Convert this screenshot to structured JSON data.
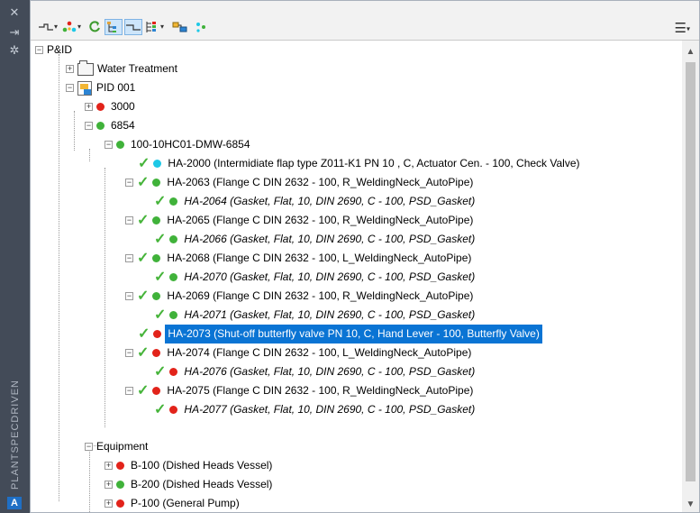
{
  "palette": {
    "title": "PLANTSPECDRIVEN",
    "close_glyph": "✕",
    "pin_glyph": "⇥",
    "settings_glyph": "✲",
    "logo_text": "A"
  },
  "toolbar": {
    "menu_glyph": "☰",
    "menu_caret": "▾"
  },
  "tree": {
    "rows": [
      {
        "text": "P&ID"
      },
      {
        "text": "Water Treatment"
      },
      {
        "text": "PID 001"
      },
      {
        "text": "3000"
      },
      {
        "text": "6854"
      },
      {
        "text": "100-10HC01-DMW-6854"
      },
      {
        "text": "HA-2000 (Intermidiate flap type Z011-K1 PN 10 , C, Actuator Cen. - 100, Check Valve)"
      },
      {
        "text": "HA-2063 (Flange C DIN 2632 - 100, R_WeldingNeck_AutoPipe)"
      },
      {
        "text": "HA-2064 (Gasket, Flat, 10, DIN 2690, C - 100, PSD_Gasket)"
      },
      {
        "text": "HA-2065 (Flange C DIN 2632 - 100, R_WeldingNeck_AutoPipe)"
      },
      {
        "text": "HA-2066 (Gasket, Flat, 10, DIN 2690, C - 100, PSD_Gasket)"
      },
      {
        "text": "HA-2068 (Flange C DIN 2632 - 100, L_WeldingNeck_AutoPipe)"
      },
      {
        "text": "HA-2070 (Gasket, Flat, 10, DIN 2690, C - 100, PSD_Gasket)"
      },
      {
        "text": "HA-2069 (Flange C DIN 2632 - 100, R_WeldingNeck_AutoPipe)"
      },
      {
        "text": "HA-2071 (Gasket, Flat, 10, DIN 2690, C - 100, PSD_Gasket)"
      },
      {
        "text": "HA-2073 (Shut-off butterfly valve PN 10, C, Hand Lever - 100, Butterfly Valve)"
      },
      {
        "text": "HA-2074 (Flange C DIN 2632 - 100, L_WeldingNeck_AutoPipe)"
      },
      {
        "text": "HA-2076 (Gasket, Flat, 10, DIN 2690, C - 100, PSD_Gasket)"
      },
      {
        "text": "HA-2075 (Flange C DIN 2632 - 100, R_WeldingNeck_AutoPipe)"
      },
      {
        "text": "HA-2077 (Gasket, Flat, 10, DIN 2690, C - 100, PSD_Gasket)"
      },
      {
        "text": "Equipment"
      },
      {
        "text": "B-100 (Dished Heads Vessel)"
      },
      {
        "text": "B-200 (Dished Heads Vessel)"
      },
      {
        "text": "P-100 (General Pump)"
      }
    ]
  },
  "colors": {
    "status_red": "#e2231a",
    "status_green": "#40b23a",
    "status_cyan": "#1ec8e6",
    "selection": "#0a74d4"
  }
}
